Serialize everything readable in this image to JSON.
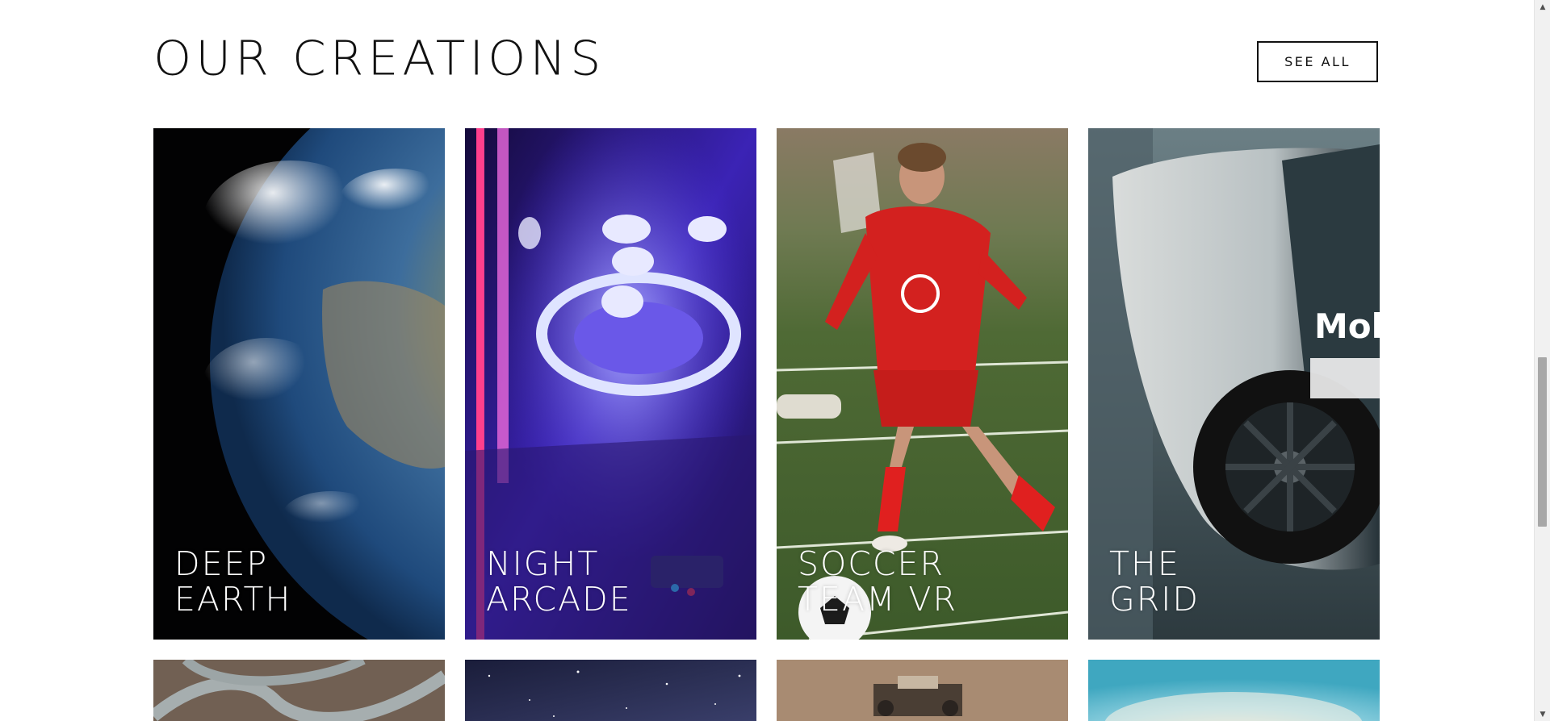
{
  "section": {
    "title": "OUR CREATIONS",
    "see_all_label": "SEE ALL"
  },
  "cards": [
    {
      "label": "DEEP\nEARTH",
      "image": "earth-from-space"
    },
    {
      "label": "NIGHT\nARCADE",
      "image": "skee-ball-neon"
    },
    {
      "label": "SOCCER\nTEAM VR",
      "image": "soccer-player-red-kit"
    },
    {
      "label": "THE\nGRID",
      "image": "race-car-wheel"
    }
  ],
  "next_row": [
    {
      "image": "winding-road-aerial"
    },
    {
      "image": "starry-night-sky"
    },
    {
      "image": "mars-rover"
    },
    {
      "image": "sky-clouds-fisheye"
    }
  ],
  "scrollbar": {
    "up_icon": "arrow-up-icon",
    "down_icon": "arrow-down-icon"
  }
}
